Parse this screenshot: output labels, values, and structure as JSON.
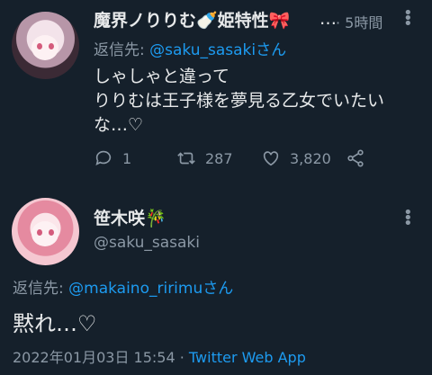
{
  "reply": {
    "display_name": "魔界ノりりむ🍼姫特性🎀",
    "ellipsis": "…",
    "time": "· 5時間",
    "reply_prefix": "返信先: ",
    "reply_handle": "@saku_sasakiさん",
    "text_line1": "しゃしゃと違って",
    "text_line2": "りりむは王子様を夢見る乙女でいたい",
    "text_line3": "な…♡",
    "reply_count": "1",
    "retweet_count": "287",
    "like_count": "3,820"
  },
  "main": {
    "display_name": "笹木咲🎋",
    "handle": "@saku_sasaki",
    "reply_prefix": "返信先: ",
    "reply_handle": "@makaino_ririmuさん",
    "text": "黙れ…♡",
    "date": "2022年01月03日 15:54 · ",
    "source": "Twitter Web App"
  },
  "icons": [
    "reply-icon",
    "retweet-icon",
    "like-icon",
    "share-icon",
    "more-icon"
  ],
  "colors": {
    "background": "#15202b",
    "accent": "#1d9bf0",
    "secondary": "#8b98a5",
    "text": "#e7e9ea"
  }
}
